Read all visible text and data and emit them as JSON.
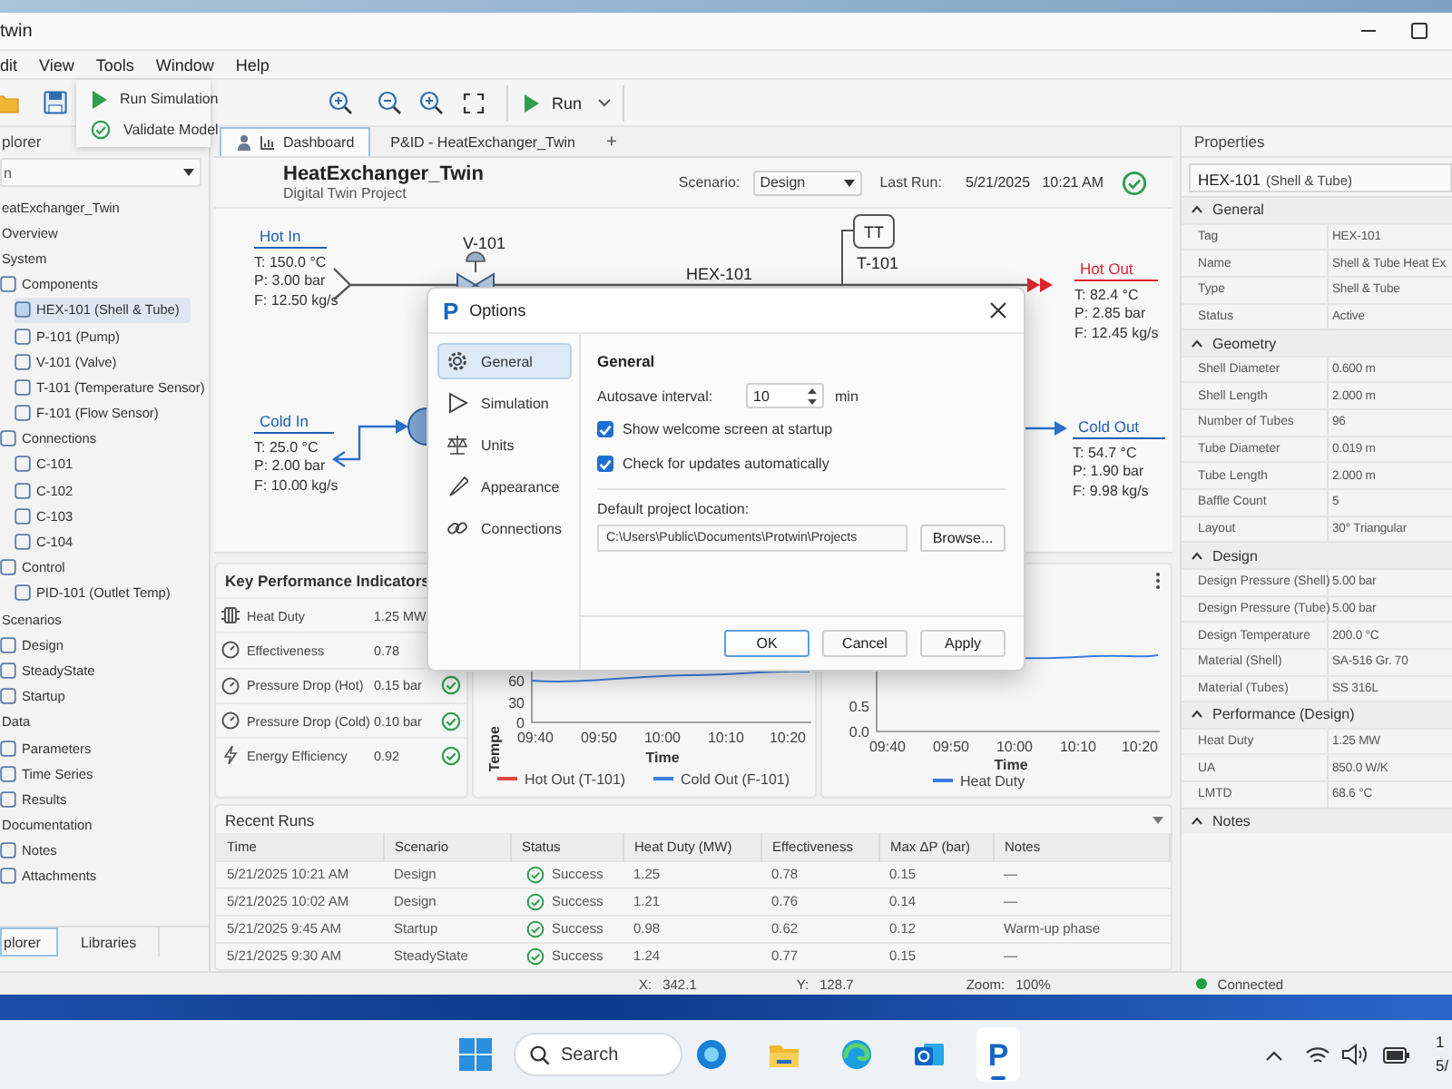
{
  "window": {
    "title": "twin"
  },
  "menu": [
    "dit",
    "View",
    "Tools",
    "Window",
    "Help"
  ],
  "toolbar": {
    "run_label": "Run"
  },
  "run_menu": [
    {
      "label": "Run Simulation",
      "kind": "run"
    },
    {
      "label": "Validate Model",
      "kind": "validate"
    }
  ],
  "explorer": {
    "title": "plorer",
    "filter": "n",
    "tree": [
      {
        "label": "eatExchanger_Twin",
        "selected": false,
        "children": [
          {
            "label": "Overview",
            "selected": false
          },
          {
            "label": "System",
            "selected": false,
            "children": [
              {
                "label": "Components",
                "selected": false,
                "children": [
                  {
                    "label": "HEX-101 (Shell & Tube)",
                    "selected": true
                  },
                  {
                    "label": "P-101 (Pump)",
                    "selected": false
                  },
                  {
                    "label": "V-101 (Valve)",
                    "selected": false
                  },
                  {
                    "label": "T-101 (Temperature Sensor)",
                    "selected": false
                  },
                  {
                    "label": "F-101 (Flow Sensor)",
                    "selected": false
                  }
                ]
              },
              {
                "label": "Connections",
                "selected": false,
                "children": [
                  {
                    "label": "C-101",
                    "selected": false
                  },
                  {
                    "label": "C-102",
                    "selected": false
                  },
                  {
                    "label": "C-103",
                    "selected": false
                  },
                  {
                    "label": "C-104",
                    "selected": false
                  }
                ]
              },
              {
                "label": "Control",
                "selected": false,
                "children": [
                  {
                    "label": "PID-101 (Outlet Temp)",
                    "selected": false
                  }
                ]
              }
            ]
          },
          {
            "label": "Scenarios",
            "selected": false,
            "children": [
              {
                "label": "Design",
                "selected": false
              },
              {
                "label": "SteadyState",
                "selected": false
              },
              {
                "label": "Startup",
                "selected": false
              }
            ]
          },
          {
            "label": "Data",
            "selected": false,
            "children": [
              {
                "label": "Parameters",
                "selected": false
              },
              {
                "label": "Time Series",
                "selected": false
              },
              {
                "label": "Results",
                "selected": false
              }
            ]
          },
          {
            "label": "Documentation",
            "selected": false,
            "children": [
              {
                "label": "Notes",
                "selected": false
              },
              {
                "label": "Attachments",
                "selected": false
              }
            ]
          }
        ]
      }
    ],
    "bottom_tabs": [
      {
        "label": "plorer",
        "selected": true
      },
      {
        "label": "Libraries",
        "selected": false
      }
    ]
  },
  "doc_tabs": [
    {
      "label": "Dashboard",
      "selected": true
    },
    {
      "label": "P&ID - HeatExchanger_Twin",
      "selected": false
    }
  ],
  "new_tab": "+",
  "dashboard": {
    "title": "HeatExchanger_Twin",
    "subtitle": "Digital Twin Project",
    "scenario_label": "Scenario:",
    "scenario": "Design",
    "last_run_label": "Last Run:",
    "last_run": "5/21/2025   10:21 AM",
    "last_run_ok": true
  },
  "diagram": {
    "streams": [
      {
        "kind": "hot_in",
        "name": "Hot In",
        "color": "#1f5fb4",
        "values": [
          "T: 150.0 °C",
          "P: 3.00 bar",
          "F: 12.50 kg/s"
        ]
      },
      {
        "kind": "cold_in",
        "name": "Cold In",
        "color": "#1f5fb4",
        "values": [
          "T: 25.0 °C",
          "P: 2.00 bar",
          "F: 10.00 kg/s"
        ]
      },
      {
        "kind": "hot_out",
        "name": "Hot Out",
        "color": "#e0242b",
        "values": [
          "T: 82.4 °C",
          "P: 2.85 bar",
          "F: 12.45 kg/s"
        ]
      },
      {
        "kind": "cold_out",
        "name": "Cold Out",
        "color": "#1f5fb4",
        "values": [
          "T: 54.7 °C",
          "P: 1.90 bar",
          "F: 9.98 kg/s"
        ]
      }
    ],
    "equipment": [
      {
        "kind": "valve",
        "tag": "V-101"
      },
      {
        "kind": "exchanger",
        "tag": "HEX-101"
      },
      {
        "kind": "sensor",
        "tag": "T-101",
        "symbol": "TT"
      }
    ]
  },
  "kpis": {
    "title": "Key Performance Indicators",
    "items": [
      {
        "kind": "heat",
        "label": "Heat Duty",
        "value": "1.25 MW"
      },
      {
        "kind": "gauge",
        "label": "Effectiveness",
        "value": "0.78"
      },
      {
        "kind": "gauge",
        "label": "Pressure Drop (Hot)",
        "value": "0.15 bar",
        "ok": true
      },
      {
        "kind": "gauge",
        "label": "Pressure Drop (Cold)",
        "value": "0.10 bar",
        "ok": true
      },
      {
        "kind": "energy",
        "label": "Energy Efficiency",
        "value": "0.92",
        "ok": true
      }
    ]
  },
  "charts": [
    {
      "ylabel": "Tempe",
      "yticks": [
        "60",
        "30",
        "0"
      ],
      "xticks": [
        "09:40",
        "09:50",
        "10:00",
        "10:10",
        "10:20"
      ],
      "xlabel": "Time",
      "legend": [
        {
          "name": "Hot Out (T-101)",
          "color": "#e04848"
        },
        {
          "name": "Cold Out (F-101)",
          "color": "#3b7de0"
        }
      ]
    },
    {
      "yticks": [
        "0.5",
        "0.0"
      ],
      "xticks": [
        "09:40",
        "09:50",
        "10:00",
        "10:10",
        "10:20"
      ],
      "xlabel": "Time",
      "legend": [
        {
          "name": "Heat Duty",
          "color": "#3b7de0"
        }
      ]
    }
  ],
  "recent_runs": {
    "title": "Recent Runs",
    "columns": [
      "Time",
      "Scenario",
      "Status",
      "Heat Duty (MW)",
      "Effectiveness",
      "Max ΔP (bar)",
      "Notes"
    ],
    "rows": [
      {
        "cells": [
          "5/21/2025 10:21 AM",
          "Design",
          "Success",
          "1.25",
          "0.78",
          "0.15",
          "—"
        ],
        "ok": true
      },
      {
        "cells": [
          "5/21/2025 10:02 AM",
          "Design",
          "Success",
          "1.21",
          "0.76",
          "0.14",
          "—"
        ],
        "ok": true
      },
      {
        "cells": [
          "5/21/2025 9:45 AM",
          "Startup",
          "Success",
          "0.98",
          "0.62",
          "0.12",
          "Warm-up phase"
        ],
        "ok": true
      },
      {
        "cells": [
          "5/21/2025 9:30 AM",
          "SteadyState",
          "Success",
          "1.24",
          "0.77",
          "0.15",
          "—"
        ],
        "ok": true
      }
    ]
  },
  "properties": {
    "title": "Properties",
    "selection": "HEX-101",
    "selection_detail": "(Shell & Tube)",
    "sections": [
      {
        "title": "General",
        "expanded": true,
        "rows": [
          [
            "Tag",
            "HEX-101"
          ],
          [
            "Name",
            "Shell & Tube Heat Ex"
          ],
          [
            "Type",
            "Shell & Tube"
          ],
          [
            "Status",
            "Active"
          ]
        ]
      },
      {
        "title": "Geometry",
        "expanded": true,
        "rows": [
          [
            "Shell Diameter",
            "0.600 m"
          ],
          [
            "Shell Length",
            "2.000 m"
          ],
          [
            "Number of Tubes",
            "96"
          ],
          [
            "Tube Diameter",
            "0.019 m"
          ],
          [
            "Tube Length",
            "2.000 m"
          ],
          [
            "Baffle Count",
            "5"
          ],
          [
            "Layout",
            "30° Triangular"
          ]
        ]
      },
      {
        "title": "Design",
        "expanded": true,
        "rows": [
          [
            "Design Pressure (Shell)",
            "5.00 bar"
          ],
          [
            "Design Pressure (Tube)",
            "5.00 bar"
          ],
          [
            "Design Temperature",
            "200.0 °C"
          ],
          [
            "Material (Shell)",
            "SA-516 Gr. 70"
          ],
          [
            "Material (Tubes)",
            "SS 316L"
          ]
        ]
      },
      {
        "title": "Performance (Design)",
        "expanded": true,
        "rows": [
          [
            "Heat Duty",
            "1.25 MW"
          ],
          [
            "UA",
            "850.0 W/K"
          ],
          [
            "LMTD",
            "68.6 °C"
          ]
        ]
      },
      {
        "title": "Notes",
        "expanded": true
      }
    ]
  },
  "status_bar": {
    "coords": [
      {
        "label": "X:",
        "value": "342.1"
      },
      {
        "label": "Y:",
        "value": "128.7"
      },
      {
        "label": "Zoom:",
        "value": "100%"
      }
    ],
    "connection": {
      "label": "Connected",
      "online": true
    }
  },
  "dialog": {
    "logo": "P",
    "title": "Options",
    "nav": [
      {
        "kind": "gear",
        "label": "General",
        "selected": true
      },
      {
        "kind": "play",
        "label": "Simulation",
        "selected": false
      },
      {
        "kind": "scale",
        "label": "Units",
        "selected": false
      },
      {
        "kind": "brush",
        "label": "Appearance",
        "selected": false
      },
      {
        "kind": "link",
        "label": "Connections",
        "selected": false
      }
    ],
    "heading": "General",
    "autosave_label": "Autosave interval:",
    "autosave_value": "10",
    "autosave_unit": "min",
    "options": [
      {
        "label": "Show welcome screen at startup",
        "checked": true
      },
      {
        "label": "Check for updates automatically",
        "checked": true
      }
    ],
    "location_label": "Default project location:",
    "location": "C:\\Users\\Public\\Documents\\Protwin\\Projects",
    "browse": "Browse...",
    "buttons": [
      {
        "label": "OK",
        "kind": "default"
      },
      {
        "label": "Cancel",
        "kind": "normal"
      },
      {
        "label": "Apply",
        "kind": "normal"
      }
    ]
  },
  "taskbar": {
    "search": "Search",
    "app": {
      "letter": "P",
      "active": true
    },
    "clock": [
      "1",
      "5/"
    ]
  }
}
